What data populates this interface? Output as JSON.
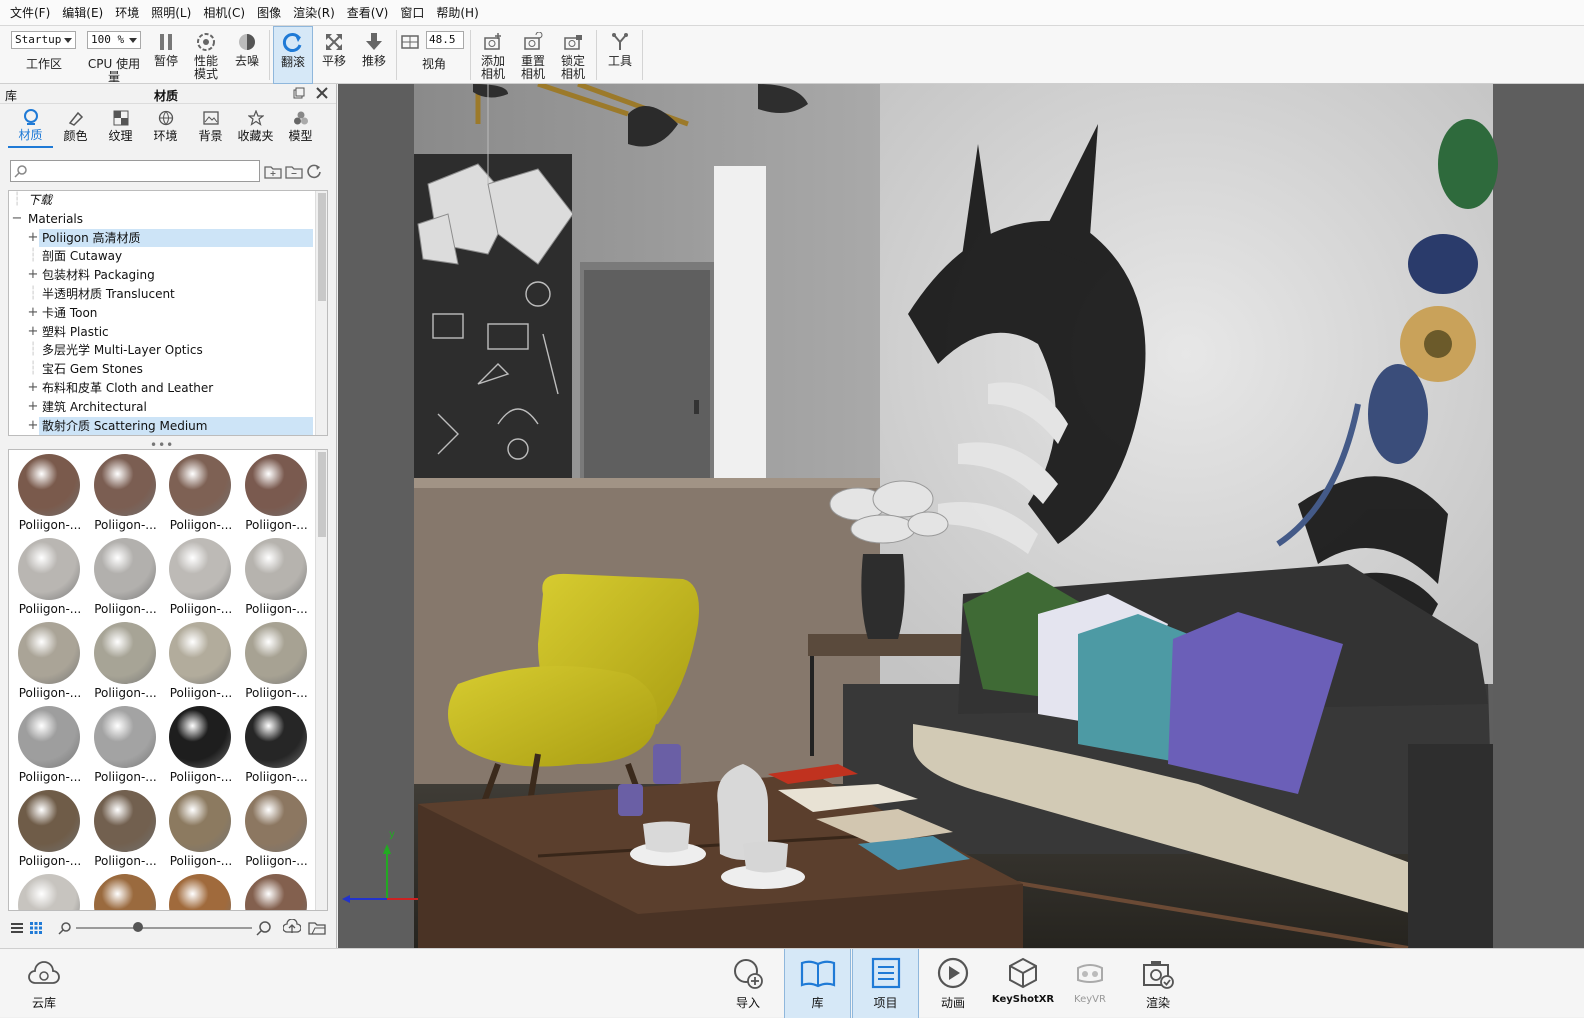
{
  "menu": [
    "文件(F)",
    "编辑(E)",
    "环境",
    "照明(L)",
    "相机(C)",
    "图像",
    "渲染(R)",
    "查看(V)",
    "窗口",
    "帮助(H)"
  ],
  "toolbar": {
    "workspace_value": "Startup",
    "workspace_label": "工作区",
    "cpu_value": "100 %",
    "cpu_label": "CPU 使用量",
    "pause_label": "暂停",
    "perf_label": "性能\n模式",
    "denoise_label": "去噪",
    "tumble_label": "翻滚",
    "pan_label": "平移",
    "dolly_label": "推移",
    "fov_value": "48.5",
    "fov_label": "视角",
    "add_camera_label": "添加\n相机",
    "reset_camera_label": "重置\n相机",
    "lock_camera_label": "锁定\n相机",
    "tools_label": "工具"
  },
  "library": {
    "panel_left_title": "库",
    "panel_title": "材质",
    "tabs": [
      "材质",
      "颜色",
      "纹理",
      "环境",
      "背景",
      "收藏夹",
      "模型"
    ],
    "search_placeholder": "",
    "tree": [
      {
        "label": "下载",
        "pm": "",
        "indent": 0,
        "italic": true
      },
      {
        "label": "Materials",
        "pm": "−",
        "indent": 0
      },
      {
        "label": "Poliigon 高清材质",
        "pm": "+",
        "indent": 1,
        "selected": true
      },
      {
        "label": "剖面 Cutaway",
        "pm": "",
        "indent": 1
      },
      {
        "label": "包装材料 Packaging",
        "pm": "+",
        "indent": 1
      },
      {
        "label": "半透明材质 Translucent",
        "pm": "",
        "indent": 1
      },
      {
        "label": "卡通 Toon",
        "pm": "+",
        "indent": 1
      },
      {
        "label": "塑料 Plastic",
        "pm": "+",
        "indent": 1
      },
      {
        "label": "多层光学 Multi-Layer Optics",
        "pm": "",
        "indent": 1
      },
      {
        "label": "宝石 Gem Stones",
        "pm": "",
        "indent": 1
      },
      {
        "label": "布料和皮革 Cloth and Leather",
        "pm": "+",
        "indent": 1
      },
      {
        "label": "建筑 Architectural",
        "pm": "+",
        "indent": 1
      },
      {
        "label": "散射介质 Scattering Medium",
        "pm": "+",
        "indent": 1,
        "selected": true
      }
    ],
    "splitter_glyph": "•••",
    "thumb_label": "Poliigon-...",
    "thumb_colors": [
      "#7a5a4c",
      "#7b5e52",
      "#7e6154",
      "#7a5a4f",
      "#b9b6b2",
      "#b2b0ad",
      "#bdbab6",
      "#b6b3ae",
      "#aaa497",
      "#a7a496",
      "#b2ac9c",
      "#a7a293",
      "#9e9e9e",
      "#a3a3a3",
      "#1e1e1e",
      "#262626",
      "#6f5c48",
      "#72604f",
      "#8c7a60",
      "#8c7761",
      "#c7c4bf",
      "#9a6a3e",
      "#a06a3c",
      "#83604e"
    ]
  },
  "viewport": {
    "axis_y": "y"
  },
  "bottombar": {
    "cloud_label": "云库",
    "import_label": "导入",
    "library_label": "库",
    "project_label": "项目",
    "animation_label": "动画",
    "keyshotxr_label": "KeyShotXR",
    "keyvr_label": "KeyVR",
    "render_label": "渲染"
  },
  "colors": {
    "accent": "#1f7ad6",
    "selection": "#cde4f7",
    "active_tool": "#d6e8f7",
    "chair": "#cbbf1e",
    "sofa": "#3a3a3a"
  }
}
